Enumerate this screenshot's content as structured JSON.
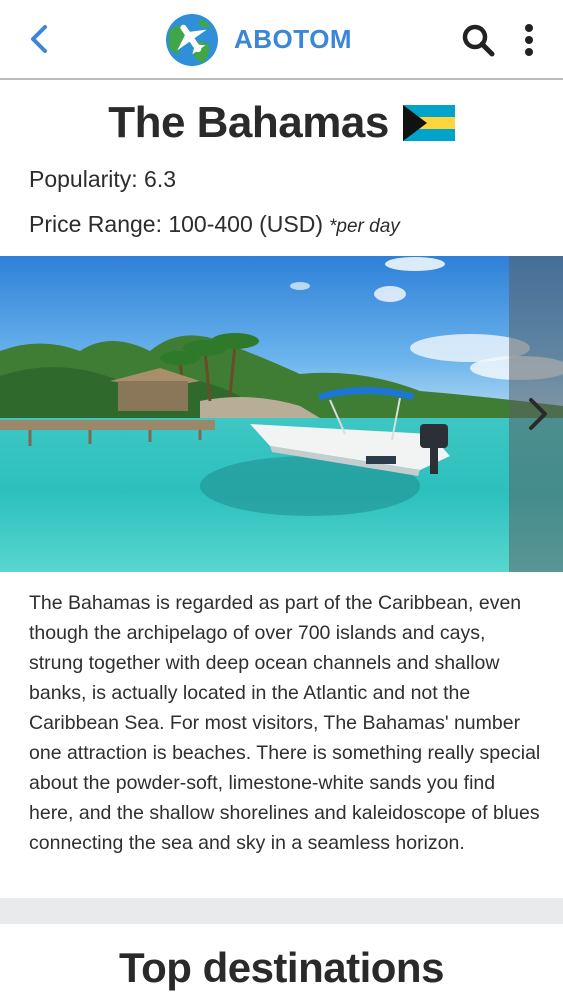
{
  "app": {
    "name": "ABOTOM",
    "accent_color": "#3b86d6",
    "icons": [
      "chevron-left-icon",
      "globe-plane-logo-icon",
      "search-icon",
      "more-vert-icon"
    ]
  },
  "destination": {
    "title": "The Bahamas",
    "flag": "bahamas-flag-icon",
    "popularity_text": "Popularity: 6.3",
    "price_range_text": "Price Range: 100-400 (USD)",
    "price_note": "*per day"
  },
  "carousel": {
    "image": "tropical-lagoon-boat-dock-photo",
    "next_icon": "chevron-right-icon"
  },
  "description": "The Bahamas is regarded as part of the Caribbean, even though the archipelago of over 700 islands and cays, strung together with deep ocean channels and shallow banks, is actually located in the Atlantic and not the Caribbean Sea. For most visitors, The Bahamas' number one attraction is beaches. There is something really special about the powder-soft, limestone-white sands you find here, and the shallow shorelines and kaleidoscope of blues connecting the sea and sky in a seamless horizon.",
  "sections": {
    "top_destinations_title": "Top destinations"
  }
}
